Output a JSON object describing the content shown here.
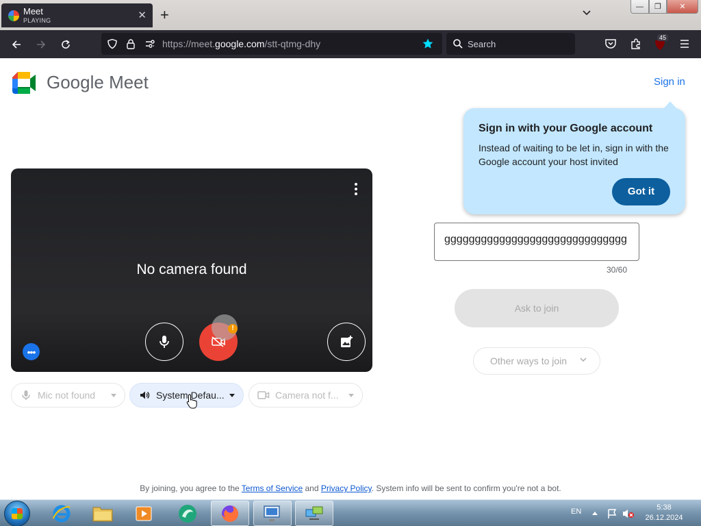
{
  "browser": {
    "tab": {
      "title": "Meet",
      "status": "PLAYING"
    },
    "url": {
      "prefix": "https://meet.",
      "domain": "google.com",
      "path": "/stt-qtmg-dhy"
    },
    "search_placeholder": "Search",
    "extension_badge": "45"
  },
  "page": {
    "brand": "Google Meet",
    "sign_in": "Sign in",
    "tooltip": {
      "heading": "Sign in with your Google account",
      "body": "Instead of waiting to be let in, sign in with the Google account your host invited",
      "button": "Got it"
    },
    "video": {
      "message": "No camera found",
      "warning_mark": "!"
    },
    "devices": {
      "mic": "Mic not found",
      "speaker": "System Defau...",
      "camera": "Camera not f..."
    },
    "name_input": {
      "value": "gggggggggggggggggggggggggggggg",
      "counter": "30/60"
    },
    "ask_to_join": "Ask to join",
    "other_ways": "Other ways to join",
    "legal": {
      "prefix": "By joining, you agree to the ",
      "terms": "Terms of Service",
      "and": " and ",
      "privacy": "Privacy Policy",
      "suffix": ". System info will be sent to confirm you're not a bot."
    }
  },
  "taskbar": {
    "language": "EN",
    "time": "5:38",
    "date": "26.12.2024"
  },
  "colors": {
    "accent_blue": "#1a73e8",
    "camera_off_red": "#ea4335",
    "tooltip_bg": "#c2e7ff",
    "browser_chrome": "#2b2a33"
  }
}
